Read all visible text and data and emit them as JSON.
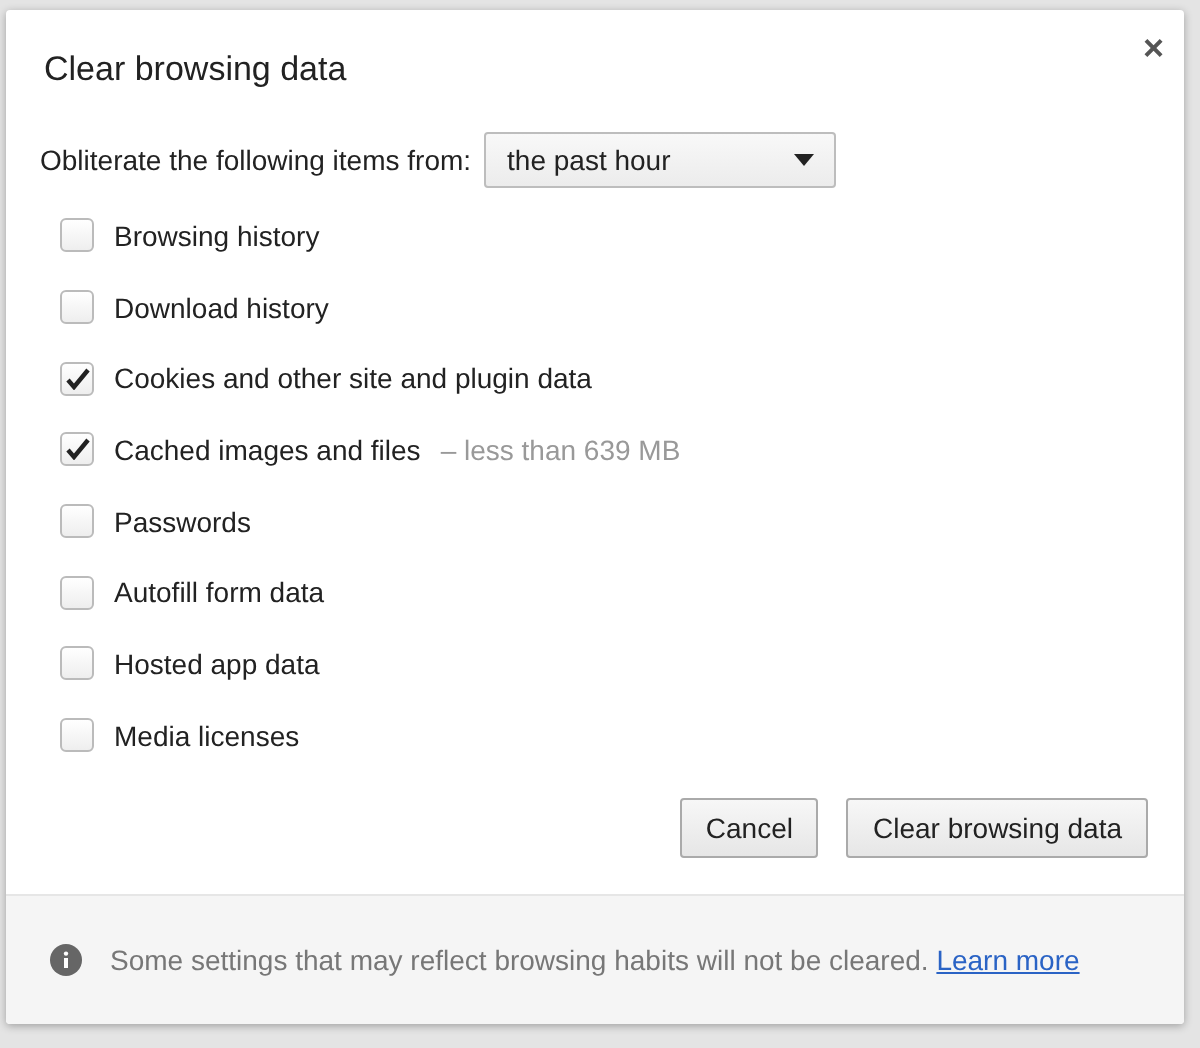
{
  "dialog": {
    "title": "Clear browsing data",
    "close": "×"
  },
  "period": {
    "label": "Obliterate the following items from:",
    "value": "the past hour"
  },
  "items": [
    {
      "label": "Browsing history",
      "checked": false
    },
    {
      "label": "Download history",
      "checked": false
    },
    {
      "label": "Cookies and other site and plugin data",
      "checked": true
    },
    {
      "label": "Cached images and files",
      "checked": true,
      "note": "–  less than 639 MB"
    },
    {
      "label": "Passwords",
      "checked": false
    },
    {
      "label": "Autofill form data",
      "checked": false
    },
    {
      "label": "Hosted app data",
      "checked": false
    },
    {
      "label": "Media licenses",
      "checked": false
    }
  ],
  "buttons": [
    "Cancel",
    "Clear browsing data"
  ],
  "footer": {
    "text": "Some settings that may reflect browsing habits will not be cleared.",
    "link": "Learn more"
  }
}
